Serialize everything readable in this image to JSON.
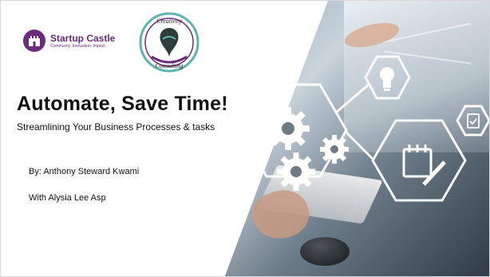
{
  "slide": {
    "title": "Automate, Save Time!",
    "subtitle": "Streamlining Your Business Processes & tasks",
    "byline": "By: Anthony Steward Kwami",
    "coauthor": "With Alysia Lee Asp"
  },
  "logos": {
    "startup_castle": {
      "name": "Startup Castle",
      "tagline": "Community. Innovation. Impact."
    },
    "creativity_consulting": {
      "top_text": "Creativity",
      "bottom_text": "Consulting"
    }
  },
  "icons": [
    "gear-icon",
    "lightbulb-icon",
    "calendar-edit-icon",
    "checklist-icon"
  ],
  "colors": {
    "brand_purple": "#6b2a7c",
    "teal": "#5bb5b0",
    "overlay_white": "#ffffff"
  }
}
